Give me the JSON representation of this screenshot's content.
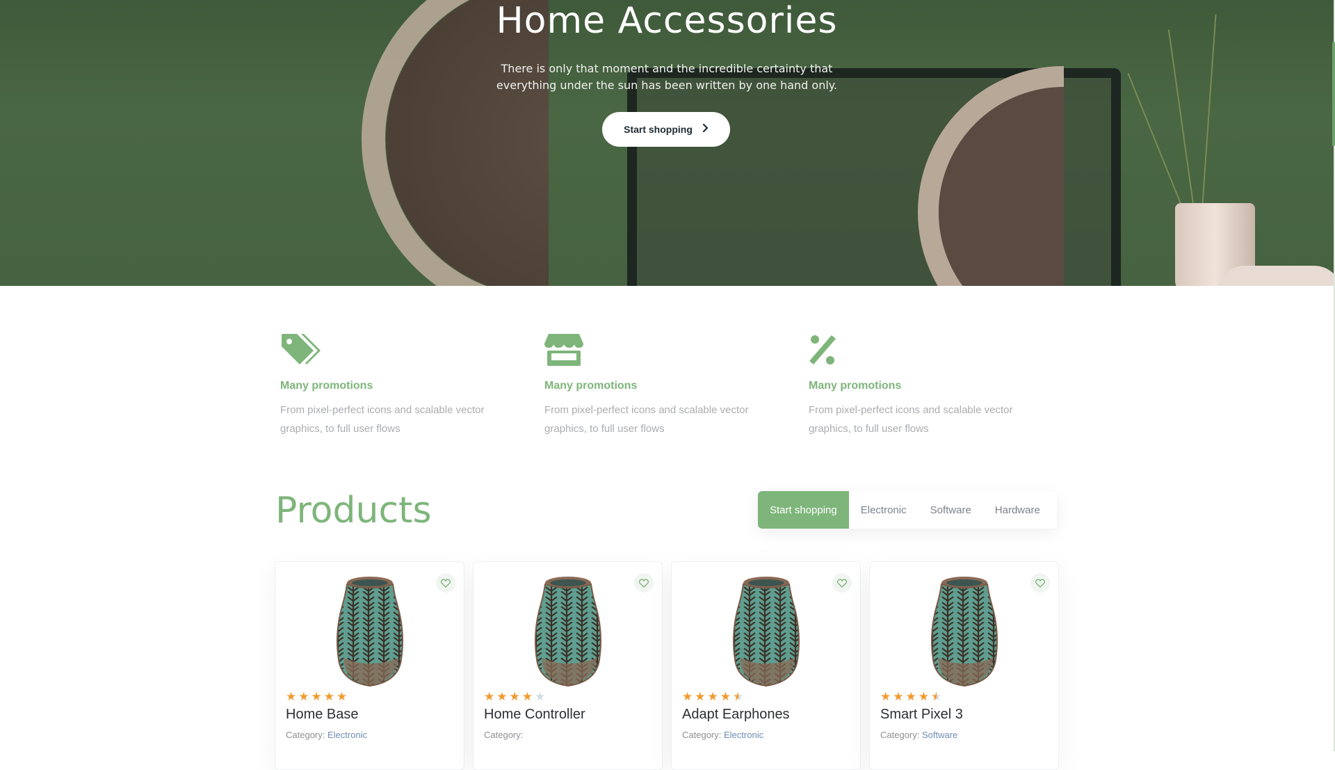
{
  "hero": {
    "title": "Home Accessories",
    "subtitle_line1": "There is only that moment and the incredible certainty that",
    "subtitle_line2": "everything under the sun has been written by one hand only.",
    "button_label": "Start shopping",
    "button_icon": "chevron-right-icon"
  },
  "features": [
    {
      "icon": "tags-icon",
      "title": "Many promotions",
      "text": "From pixel-perfect icons and scalable vector graphics, to full user flows"
    },
    {
      "icon": "store-icon",
      "title": "Many promotions",
      "text": "From pixel-perfect icons and scalable vector graphics, to full user flows"
    },
    {
      "icon": "percent-icon",
      "title": "Many promotions",
      "text": "From pixel-perfect icons and scalable vector graphics, to full user flows"
    }
  ],
  "products": {
    "title": "Products",
    "tabs": [
      {
        "label": "Start shopping",
        "active": true
      },
      {
        "label": "Electronic",
        "active": false
      },
      {
        "label": "Software",
        "active": false
      },
      {
        "label": "Hardware",
        "active": false
      }
    ],
    "items": [
      {
        "name": "Home Base",
        "category_label": "Category:",
        "category": "Electronic",
        "rating": 5
      },
      {
        "name": "Home Controller",
        "category_label": "Category:",
        "category": "",
        "rating": 4
      },
      {
        "name": "Adapt Earphones",
        "category_label": "Category:",
        "category": "Electronic",
        "rating": 4.5
      },
      {
        "name": "Smart Pixel 3",
        "category_label": "Category:",
        "category": "Software",
        "rating": 4.5
      }
    ]
  },
  "colors": {
    "accent": "#7eb57a",
    "star": "#f29a2e",
    "hero_bg": "#466240"
  }
}
